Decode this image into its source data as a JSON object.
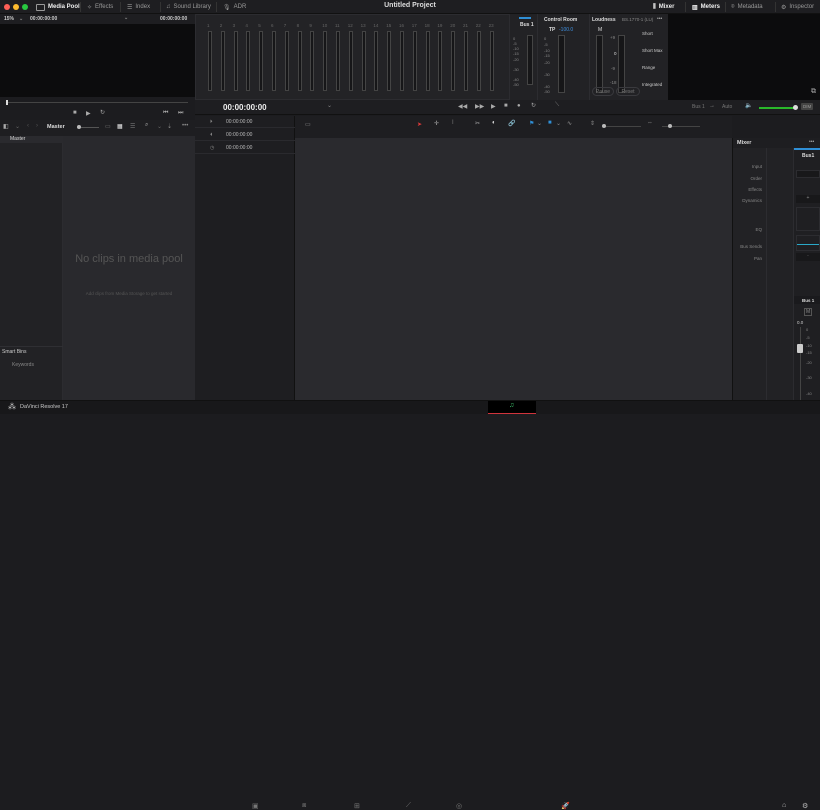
{
  "window": {
    "title": "Untitled Project"
  },
  "toolbar": {
    "left": [
      {
        "label": "Media Pool",
        "icon": "media-pool-icon"
      },
      {
        "label": "Effects",
        "icon": "effects-icon"
      },
      {
        "label": "Index",
        "icon": "index-icon"
      },
      {
        "label": "Sound Library",
        "icon": "sound-library-icon"
      },
      {
        "label": "ADR",
        "icon": "adr-icon"
      }
    ],
    "right": [
      {
        "label": "Mixer",
        "icon": "mixer-icon"
      },
      {
        "label": "Meters",
        "icon": "meters-icon"
      },
      {
        "label": "Metadata",
        "icon": "metadata-icon"
      },
      {
        "label": "Inspector",
        "icon": "inspector-icon"
      }
    ]
  },
  "viewer": {
    "zoom": "15%",
    "timecode_left": "00:00:00:00",
    "timecode_right": "00:00:00:00"
  },
  "meters": {
    "channels": [
      "1",
      "2",
      "3",
      "4",
      "5",
      "6",
      "7",
      "8",
      "9",
      "10",
      "11",
      "12",
      "13",
      "14",
      "15",
      "16",
      "17",
      "18",
      "19",
      "20",
      "21",
      "22",
      "23"
    ],
    "bus": "Bus 1",
    "bus_scale": [
      "0",
      "-5",
      "-10",
      "-15",
      "-20",
      "-30",
      "-40",
      "-50"
    ],
    "control_room": {
      "title": "Control Room",
      "tp_label": "TP",
      "tp_value": "-100.0",
      "scale": [
        "0",
        "-5",
        "-10",
        "-15",
        "-20",
        "-30",
        "-40",
        "-50"
      ]
    },
    "loudness": {
      "title": "Loudness",
      "standard": "BS.1770-1 (LU)",
      "m_label": "M",
      "scale": [
        "+9",
        "0",
        "-9",
        "-18"
      ],
      "center": "0",
      "labels": [
        "Short",
        "Short Max",
        "Range",
        "Integrated"
      ],
      "pause": "Pause",
      "reset": "Reset"
    }
  },
  "timeline": {
    "timecode": "00:00:00:00",
    "bus": "Bus 1",
    "arrow": "→",
    "mode": "Auto",
    "dim": "DIM",
    "rows": [
      "00:00:00:00",
      "00:00:00:00",
      "00:00:00:00"
    ]
  },
  "media_pool": {
    "bin": "Master",
    "master": "Master",
    "empty_title": "No clips in media pool",
    "empty_sub": "Add clips from Media Storage to get started",
    "smart_bins": "Smart Bins",
    "keywords": "Keywords"
  },
  "mixer": {
    "title": "Mixer",
    "more": "•••",
    "labels": [
      "Input",
      "Order",
      "Effects",
      "Dynamics",
      "EQ",
      "Bus Sends",
      "Pan"
    ],
    "strip": "Bus1",
    "strip_bottom": "Bus 1",
    "gain": "0.0",
    "scale": [
      "0",
      "-5",
      "-10",
      "-15",
      "-20",
      "-30",
      "-40",
      "-50"
    ]
  },
  "bottom": {
    "app": "DaVinci Resolve 17",
    "pages": [
      "media",
      "cut",
      "edit",
      "fusion",
      "color",
      "fairlight",
      "deliver"
    ],
    "active": "fairlight"
  },
  "colors": {
    "accent": "#2f8fd6",
    "active_page": "#3ec46d",
    "tab_underline": "#d0343c",
    "volume": "#2ab82a"
  }
}
